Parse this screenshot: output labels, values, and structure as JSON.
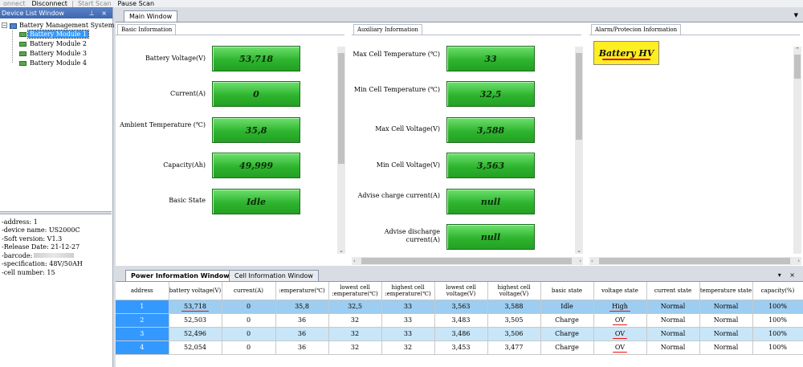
{
  "toolbar": {
    "connect": "onnect",
    "disconnect": "Disconnect",
    "start_scan": "Start Scan",
    "pause_scan": "Pause Scan"
  },
  "device_list": {
    "title": "Device List Window",
    "title_buttons": "\u0004 ×",
    "root": "Battery Management System",
    "modules": [
      "Battery Module 1",
      "Battery Module 2",
      "Battery Module 3",
      "Battery Module 4"
    ]
  },
  "device_info": [
    "address: 1",
    "device name: US2000C",
    "Soft  version: V1.3",
    "Release Date: 21-12-27",
    "barcode: ",
    "specification: 48V/50AH",
    "cell number: 15"
  ],
  "main_window": {
    "tab": "Main Window",
    "basic": {
      "title": "Basic Information",
      "fields": [
        {
          "label": "Battery Voltage(V)",
          "value": "53,718"
        },
        {
          "label": "Current(A)",
          "value": "0"
        },
        {
          "label": "Ambient Temperature (℃)",
          "value": "35,8"
        },
        {
          "label": "Capacity(Ah)",
          "value": "49,999"
        },
        {
          "label": "Basic State",
          "value": "Idle"
        }
      ]
    },
    "aux": {
      "title": "Auxiliary Information",
      "fields": [
        {
          "label": "Max Cell Temperature (℃)",
          "value": "33"
        },
        {
          "label": "Min Cell Temperature (℃)",
          "value": "32,5"
        },
        {
          "label": "Max Cell Voltage(V)",
          "value": "3,588"
        },
        {
          "label": "Min Cell Voltage(V)",
          "value": "3,563"
        },
        {
          "label": "Advise charge current(A)",
          "value": "null"
        },
        {
          "label": "Advise discharge current(A)",
          "value": "null"
        }
      ]
    },
    "alarm": {
      "title": "Alarm/Protecion Information",
      "badge": "Battery HV"
    }
  },
  "bottom_window": {
    "tabs": [
      "Power Information Window",
      "Cell Information Window"
    ],
    "columns": [
      "address",
      "battery voltage(V)",
      "current(A)",
      ":emperature(℃)",
      "lowest cell :emperature(℃)",
      "highest cell :emperature(℃)",
      "lowest cell voltage(V)",
      "highest cell voltage(V)",
      "basic state",
      "voltage state",
      "current state",
      "temperature state",
      "capacity(%)"
    ],
    "rows": [
      [
        "1",
        "53,718",
        "0",
        "35,8",
        "32,5",
        "33",
        "3,563",
        "3,588",
        "Idle",
        "High",
        "Normal",
        "Normal",
        "100%"
      ],
      [
        "2",
        "52,503",
        "0",
        "36",
        "32",
        "33",
        "3,483",
        "3,505",
        "Charge",
        "OV",
        "Normal",
        "Normal",
        "100%"
      ],
      [
        "3",
        "52,496",
        "0",
        "36",
        "32",
        "33",
        "3,486",
        "3,506",
        "Charge",
        "OV",
        "Normal",
        "Normal",
        "100%"
      ],
      [
        "4",
        "52,054",
        "0",
        "36",
        "32",
        "32",
        "3,453",
        "3,477",
        "Charge",
        "OV",
        "Normal",
        "Normal",
        "100%"
      ]
    ]
  },
  "colors": {
    "green_box": "#2fb52f",
    "alarm_yellow": "#ffee22",
    "selection_blue": "#3399ff",
    "annotation_red": "#e11111"
  }
}
